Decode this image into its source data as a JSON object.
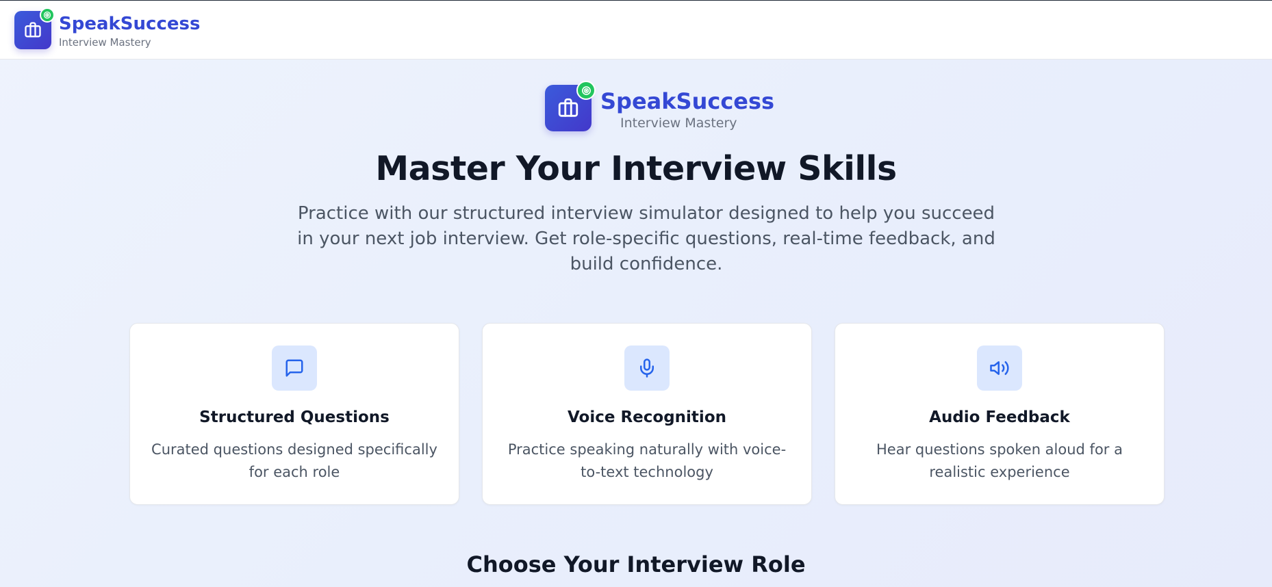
{
  "header": {
    "brand_name": "SpeakSuccess",
    "brand_tagline": "Interview Mastery",
    "logo_icon": "briefcase-icon",
    "badge_icon": "target-icon"
  },
  "hero": {
    "brand_name": "SpeakSuccess",
    "brand_tagline": "Interview Mastery",
    "title": "Master Your Interview Skills",
    "description": "Practice with our structured interview simulator designed to help you succeed in your next job interview. Get role-specific questions, real-time feedback, and build confidence."
  },
  "features": [
    {
      "icon": "message-square-icon",
      "title": "Structured Questions",
      "description": "Curated questions designed specifically for each role"
    },
    {
      "icon": "microphone-icon",
      "title": "Voice Recognition",
      "description": "Practice speaking naturally with voice-to-text technology"
    },
    {
      "icon": "speaker-icon",
      "title": "Audio Feedback",
      "description": "Hear questions spoken aloud for a realistic experience"
    }
  ],
  "roles_section": {
    "title": "Choose Your Interview Role"
  },
  "colors": {
    "brand": "#3448d4",
    "accent_green": "#22c55e",
    "icon_bg": "#dbe7fe",
    "icon_stroke": "#2563eb"
  }
}
